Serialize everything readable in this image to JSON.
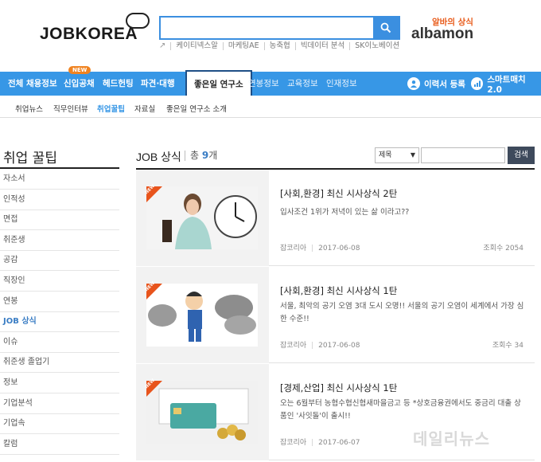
{
  "header": {
    "logo": "JOBKOREA",
    "search": {
      "value": "",
      "placeholder": ""
    },
    "keywords": [
      "케이티넥스알",
      "마케팅AE",
      "농축협",
      "빅데이터 분석",
      "SK이노베이션"
    ],
    "albamon_tagline": "알바의 상식",
    "albamon_logo": "albamon"
  },
  "gnb": {
    "items": [
      "전체 채용정보",
      "신입공채",
      "헤드헌팅",
      "파견·대행",
      "좋은일 연구소",
      "연봉정보",
      "교육정보",
      "인재정보"
    ],
    "new_badge": "NEW",
    "resume_btn": "이력서 등록",
    "smart_btn": "스마트매치 2.0"
  },
  "subnav": {
    "items": [
      "취업뉴스",
      "직무인터뷰",
      "취업꿀팁",
      "자료실",
      "좋은일 연구소 소개"
    ]
  },
  "sidebar": {
    "title": "취업 꿀팁",
    "items": [
      "자소서",
      "인적성",
      "면접",
      "취준생",
      "공감",
      "직장인",
      "연봉",
      "JOB 상식",
      "이슈",
      "취준생 졸업기",
      "정보",
      "기업분석",
      "기업속",
      "칼럼"
    ],
    "active_index": 7
  },
  "main": {
    "title": "JOB 상식",
    "count_prefix": "총",
    "count": "9",
    "count_suffix": "개",
    "filter_select": "제목",
    "filter_input": "",
    "filter_button": "검색",
    "articles": [
      {
        "badge": "NEW",
        "title": "[사회,환경] 최신 시사상식 2탄",
        "desc": "입사조건 1위가 저녁이 있는 삶 이라고??",
        "source": "잡코리아",
        "date": "2017-06-08",
        "views": "조회수 2054"
      },
      {
        "badge": "NEW",
        "title": "[사회,환경] 최신 시사상식 1탄",
        "desc": "서울, 최악의 공기 오염 3대 도시 오명!! 서울의 공기 오염이 세계에서 가장 심한 수준!!",
        "source": "잡코리아",
        "date": "2017-06-08",
        "views": "조회수 34"
      },
      {
        "badge": "NEW",
        "title": "[경제,산업] 최신 시사상식 1탄",
        "desc": "오는 6월부터 농협수협신협새마을금고 등 *상호금융권에서도 중금리 대출 상품인 '사잇돌'이 출시!!",
        "source": "잡코리아",
        "date": "2017-06-07",
        "views": ""
      }
    ]
  },
  "watermark": "데일리뉴스"
}
